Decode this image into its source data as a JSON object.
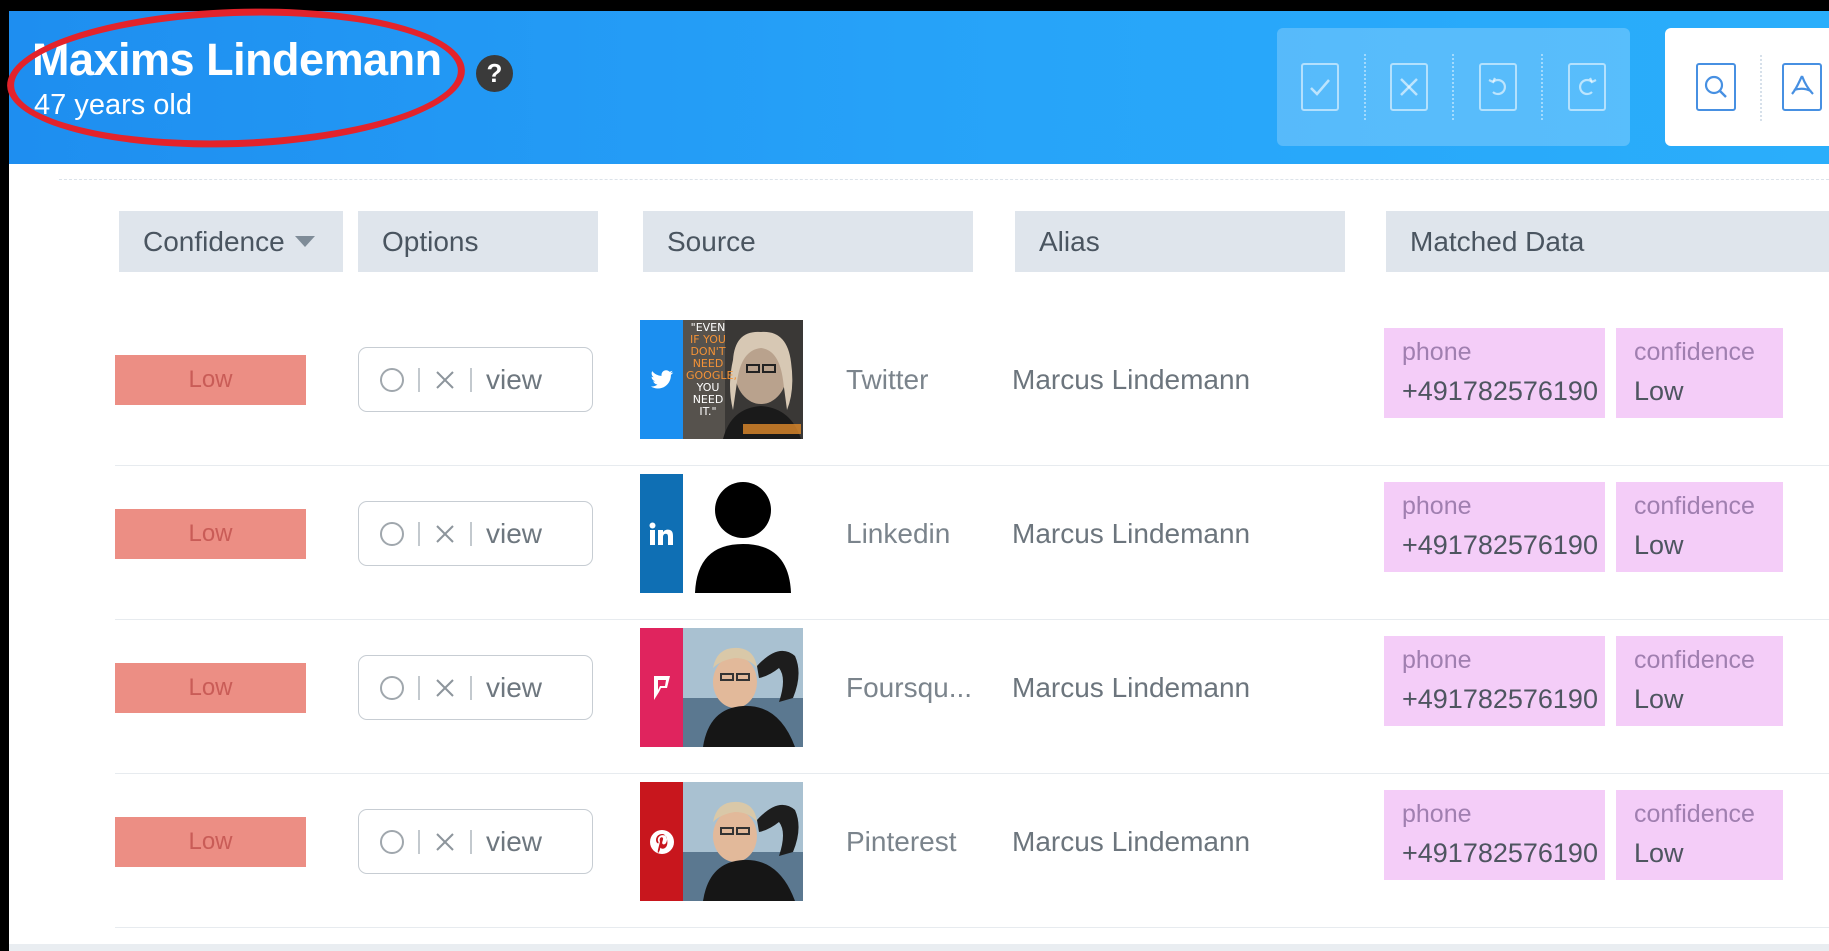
{
  "header": {
    "name": "Maxims Lindemann",
    "age": "47 years old",
    "help_glyph": "?",
    "actions": [
      "check-icon",
      "close-icon",
      "undo-icon",
      "redo-icon"
    ],
    "tools": [
      "search-icon",
      "pdf-icon"
    ]
  },
  "table": {
    "columns": {
      "confidence": "Confidence",
      "options": "Options",
      "source": "Source",
      "alias": "Alias",
      "matched": "Matched Data"
    },
    "rows": [
      {
        "confidence": "Low",
        "option_view": "view",
        "source": "Twitter",
        "source_icon": "twitter-icon",
        "source_color": "#1b8ff0",
        "alias": "Marcus Lindemann",
        "matched": [
          {
            "key": "phone",
            "value": "+491782576190"
          },
          {
            "key": "confidence",
            "value": "Low"
          }
        ]
      },
      {
        "confidence": "Low",
        "option_view": "view",
        "source": "Linkedin",
        "source_icon": "linkedin-icon",
        "source_color": "#0f6fb4",
        "alias": "Marcus Lindemann",
        "matched": [
          {
            "key": "phone",
            "value": "+491782576190"
          },
          {
            "key": "confidence",
            "value": "Low"
          }
        ]
      },
      {
        "confidence": "Low",
        "option_view": "view",
        "source": "Foursqu...",
        "source_icon": "foursquare-icon",
        "source_color": "#e0245e",
        "alias": "Marcus Lindemann",
        "matched": [
          {
            "key": "phone",
            "value": "+491782576190"
          },
          {
            "key": "confidence",
            "value": "Low"
          }
        ]
      },
      {
        "confidence": "Low",
        "option_view": "view",
        "source": "Pinterest",
        "source_icon": "pinterest-icon",
        "source_color": "#c8161d",
        "alias": "Marcus Lindemann",
        "matched": [
          {
            "key": "phone",
            "value": "+491782576190"
          },
          {
            "key": "confidence",
            "value": "Low"
          }
        ]
      }
    ]
  },
  "photo_text": {
    "lines": [
      "\"EVEN",
      "IF YOU",
      "DON'T",
      "NEED",
      "GOOGLE,",
      "YOU",
      "NEED",
      "IT.\""
    ]
  }
}
